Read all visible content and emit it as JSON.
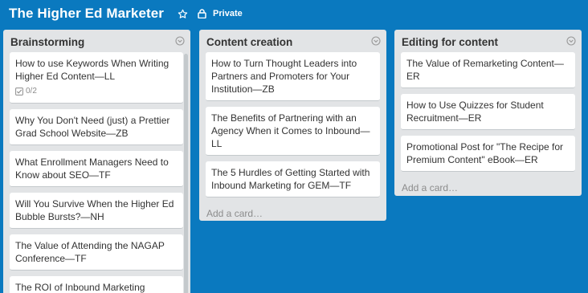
{
  "board": {
    "title": "The Higher Ed Marketer",
    "privacy_label": "Private"
  },
  "lists": [
    {
      "title": "Brainstorming",
      "cards": [
        {
          "text": "How to use Keywords When Writing Higher Ed Content—LL",
          "checklist": "0/2"
        },
        {
          "text": "Why You Don't Need (just) a Prettier Grad School Website—ZB"
        },
        {
          "text": "What Enrollment Managers Need to Know about SEO—TF"
        },
        {
          "text": "Will You Survive When the Higher Ed Bubble Bursts?—NH"
        },
        {
          "text": "The Value of Attending the NAGAP Conference—TF"
        },
        {
          "text": "The ROI of Inbound Marketing"
        }
      ]
    },
    {
      "title": "Content creation",
      "cards": [
        {
          "text": "How to Turn Thought Leaders into Partners and Promoters for Your Institution—ZB"
        },
        {
          "text": "The Benefits of Partnering with an Agency When it Comes to Inbound—LL"
        },
        {
          "text": "The 5 Hurdles of Getting Started with Inbound Marketing for GEM—TF"
        }
      ],
      "add_card": "Add a card…"
    },
    {
      "title": "Editing for content",
      "cards": [
        {
          "text": "The Value of Remarketing Content—ER"
        },
        {
          "text": "How to Use Quizzes for Student Recruitment—ER"
        },
        {
          "text": "Promotional Post for \"The Recipe for Premium Content\" eBook—ER"
        }
      ],
      "add_card": "Add a card…"
    }
  ],
  "icons": {
    "star": "star-icon",
    "lock": "lock-icon",
    "list_menu": "chevron-down-circle-icon",
    "checklist": "checklist-icon"
  },
  "colors": {
    "board_background": "#0a79bf",
    "list_background": "#e2e4e6",
    "card_background": "#ffffff",
    "text": "#333333",
    "muted_text": "#8c8c8c"
  }
}
